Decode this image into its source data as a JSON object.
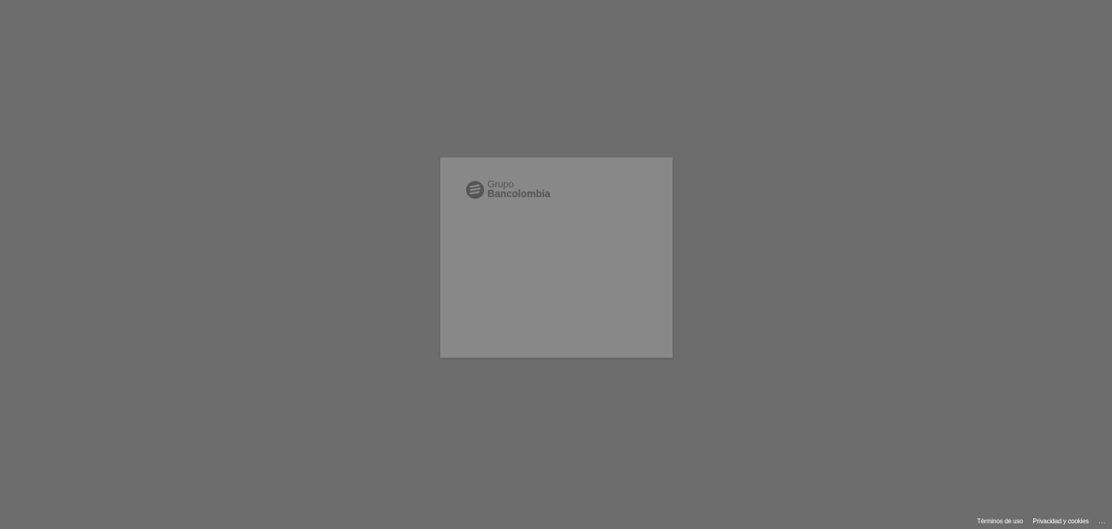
{
  "card": {
    "logo": {
      "line1": "Grupo",
      "line2": "Bancolombia",
      "icon": "bancolombia-logo-icon"
    }
  },
  "footer": {
    "terms_label": "Términos de uso",
    "privacy_label": "Privacidad y cookies",
    "more_label": "..."
  },
  "colors": {
    "background": "#6d6d6d",
    "card": "#888888",
    "logo": "#555555",
    "footer_text": "#ffffff"
  }
}
